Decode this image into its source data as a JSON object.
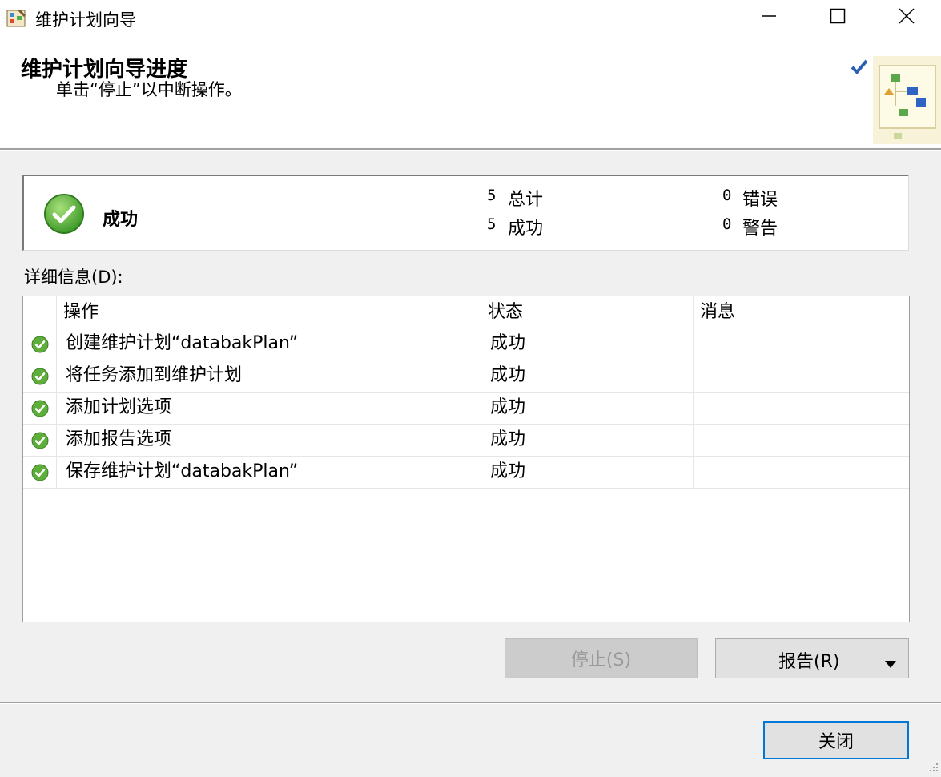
{
  "window": {
    "title": "维护计划向导",
    "icon": "wizard-app-icon",
    "controls": [
      "minimize-icon",
      "maximize-icon",
      "close-icon"
    ]
  },
  "header": {
    "title": "维护计划向导进度",
    "subtitle": "单击“停止”以中断操作。",
    "art": "maintenance-plan-flowchart-icon"
  },
  "summary": {
    "status": "成功",
    "status_icon": "success-check-icon",
    "total_count": "5",
    "total_label": "总计",
    "success_count": "5",
    "success_label": "成功",
    "error_count": "0",
    "error_label": "错误",
    "warning_count": "0",
    "warning_label": "警告"
  },
  "details": {
    "label": "详细信息(D):",
    "columns": [
      "操作",
      "状态",
      "消息"
    ],
    "rows": [
      {
        "action": "创建维护计划“databakPlan”",
        "status": "成功",
        "message": ""
      },
      {
        "action": "将任务添加到维护计划",
        "status": "成功",
        "message": ""
      },
      {
        "action": "添加计划选项",
        "status": "成功",
        "message": ""
      },
      {
        "action": "添加报告选项",
        "status": "成功",
        "message": ""
      },
      {
        "action": "保存维护计划“databakPlan”",
        "status": "成功",
        "message": ""
      }
    ]
  },
  "buttons": {
    "stop": "停止(S)",
    "report": "报告(R)",
    "close": "关闭"
  },
  "colors": {
    "success_green": "#5fae3c",
    "focus_border": "#0078d7",
    "accent_check": "#2b5fb4"
  }
}
